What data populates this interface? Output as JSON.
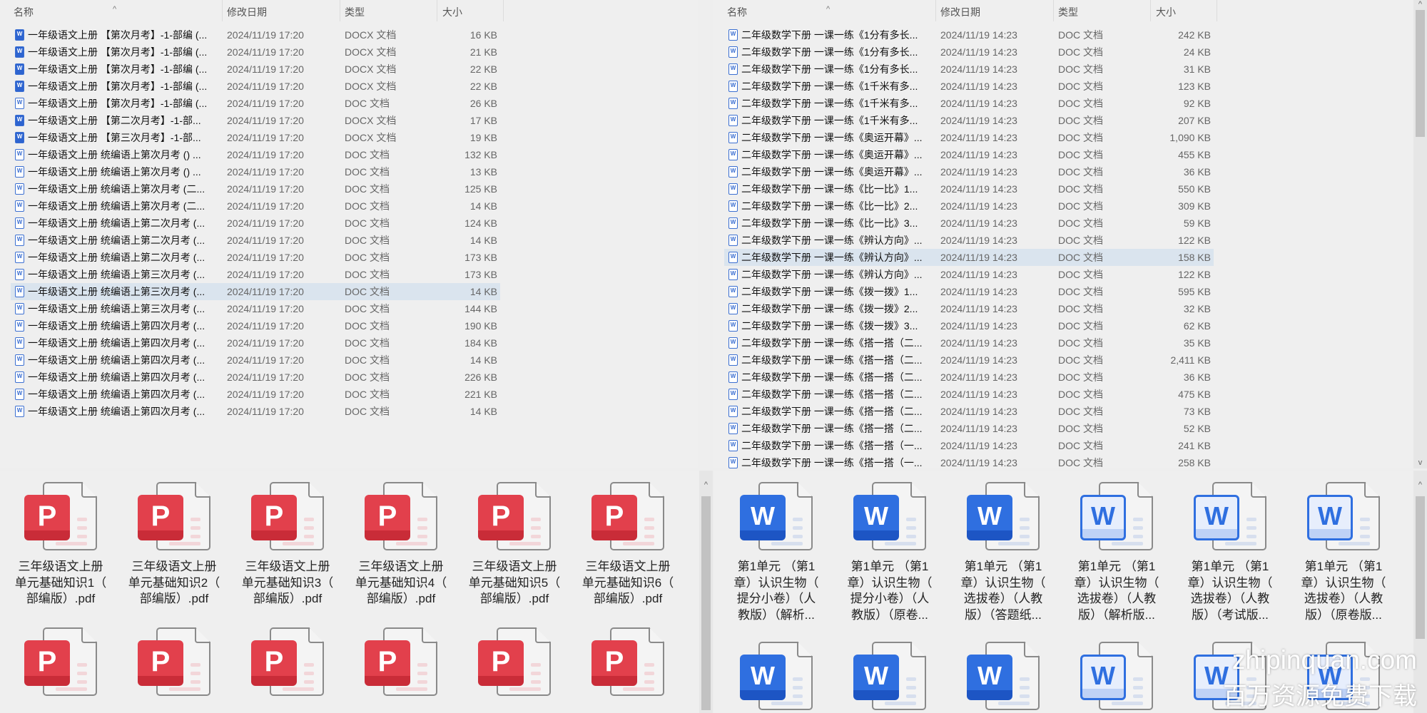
{
  "left_list": {
    "columns": {
      "name": "名称",
      "date": "修改日期",
      "type": "类型",
      "size": "大小"
    },
    "selected_index": 15,
    "rows": [
      {
        "name": "一年级语文上册 【第次月考】-1-部编 (...",
        "date": "2024/11/19 17:20",
        "type": "DOCX 文档",
        "size": "16 KB",
        "icon": "docx"
      },
      {
        "name": "一年级语文上册 【第次月考】-1-部编 (...",
        "date": "2024/11/19 17:20",
        "type": "DOCX 文档",
        "size": "21 KB",
        "icon": "docx"
      },
      {
        "name": "一年级语文上册 【第次月考】-1-部编 (...",
        "date": "2024/11/19 17:20",
        "type": "DOCX 文档",
        "size": "22 KB",
        "icon": "docx"
      },
      {
        "name": "一年级语文上册 【第次月考】-1-部编 (...",
        "date": "2024/11/19 17:20",
        "type": "DOCX 文档",
        "size": "22 KB",
        "icon": "docx"
      },
      {
        "name": "一年级语文上册 【第次月考】-1-部编 (...",
        "date": "2024/11/19 17:20",
        "type": "DOC 文档",
        "size": "26 KB",
        "icon": "doc"
      },
      {
        "name": "一年级语文上册 【第二次月考】-1-部...",
        "date": "2024/11/19 17:20",
        "type": "DOCX 文档",
        "size": "17 KB",
        "icon": "docx"
      },
      {
        "name": "一年级语文上册 【第三次月考】-1-部...",
        "date": "2024/11/19 17:20",
        "type": "DOCX 文档",
        "size": "19 KB",
        "icon": "docx"
      },
      {
        "name": "一年级语文上册 统编语上第次月考 () ...",
        "date": "2024/11/19 17:20",
        "type": "DOC 文档",
        "size": "132 KB",
        "icon": "doc"
      },
      {
        "name": "一年级语文上册 统编语上第次月考 () ...",
        "date": "2024/11/19 17:20",
        "type": "DOC 文档",
        "size": "13 KB",
        "icon": "doc"
      },
      {
        "name": "一年级语文上册 统编语上第次月考 (二...",
        "date": "2024/11/19 17:20",
        "type": "DOC 文档",
        "size": "125 KB",
        "icon": "doc"
      },
      {
        "name": "一年级语文上册 统编语上第次月考 (二...",
        "date": "2024/11/19 17:20",
        "type": "DOC 文档",
        "size": "14 KB",
        "icon": "doc"
      },
      {
        "name": "一年级语文上册 统编语上第二次月考 (...",
        "date": "2024/11/19 17:20",
        "type": "DOC 文档",
        "size": "124 KB",
        "icon": "doc"
      },
      {
        "name": "一年级语文上册 统编语上第二次月考 (...",
        "date": "2024/11/19 17:20",
        "type": "DOC 文档",
        "size": "14 KB",
        "icon": "doc"
      },
      {
        "name": "一年级语文上册 统编语上第二次月考 (...",
        "date": "2024/11/19 17:20",
        "type": "DOC 文档",
        "size": "173 KB",
        "icon": "doc"
      },
      {
        "name": "一年级语文上册 统编语上第三次月考 (...",
        "date": "2024/11/19 17:20",
        "type": "DOC 文档",
        "size": "173 KB",
        "icon": "doc"
      },
      {
        "name": "一年级语文上册 统编语上第三次月考 (...",
        "date": "2024/11/19 17:20",
        "type": "DOC 文档",
        "size": "14 KB",
        "icon": "doc"
      },
      {
        "name": "一年级语文上册 统编语上第三次月考 (...",
        "date": "2024/11/19 17:20",
        "type": "DOC 文档",
        "size": "144 KB",
        "icon": "doc"
      },
      {
        "name": "一年级语文上册 统编语上第四次月考 (...",
        "date": "2024/11/19 17:20",
        "type": "DOC 文档",
        "size": "190 KB",
        "icon": "doc"
      },
      {
        "name": "一年级语文上册 统编语上第四次月考 (...",
        "date": "2024/11/19 17:20",
        "type": "DOC 文档",
        "size": "184 KB",
        "icon": "doc"
      },
      {
        "name": "一年级语文上册 统编语上第四次月考 (...",
        "date": "2024/11/19 17:20",
        "type": "DOC 文档",
        "size": "14 KB",
        "icon": "doc"
      },
      {
        "name": "一年级语文上册 统编语上第四次月考 (...",
        "date": "2024/11/19 17:20",
        "type": "DOC 文档",
        "size": "226 KB",
        "icon": "doc"
      },
      {
        "name": "一年级语文上册 统编语上第四次月考 (...",
        "date": "2024/11/19 17:20",
        "type": "DOC 文档",
        "size": "221 KB",
        "icon": "doc"
      },
      {
        "name": "一年级语文上册 统编语上第四次月考 (...",
        "date": "2024/11/19 17:20",
        "type": "DOC 文档",
        "size": "14 KB",
        "icon": "doc"
      }
    ]
  },
  "right_list": {
    "columns": {
      "name": "名称",
      "date": "修改日期",
      "type": "类型",
      "size": "大小"
    },
    "selected_index": 13,
    "rows": [
      {
        "name": "二年级数学下册 一课一练《1分有多长...",
        "date": "2024/11/19 14:23",
        "type": "DOC 文档",
        "size": "242 KB",
        "icon": "doc"
      },
      {
        "name": "二年级数学下册 一课一练《1分有多长...",
        "date": "2024/11/19 14:23",
        "type": "DOC 文档",
        "size": "24 KB",
        "icon": "doc"
      },
      {
        "name": "二年级数学下册 一课一练《1分有多长...",
        "date": "2024/11/19 14:23",
        "type": "DOC 文档",
        "size": "31 KB",
        "icon": "doc"
      },
      {
        "name": "二年级数学下册 一课一练《1千米有多...",
        "date": "2024/11/19 14:23",
        "type": "DOC 文档",
        "size": "123 KB",
        "icon": "doc"
      },
      {
        "name": "二年级数学下册 一课一练《1千米有多...",
        "date": "2024/11/19 14:23",
        "type": "DOC 文档",
        "size": "92 KB",
        "icon": "doc"
      },
      {
        "name": "二年级数学下册 一课一练《1千米有多...",
        "date": "2024/11/19 14:23",
        "type": "DOC 文档",
        "size": "207 KB",
        "icon": "doc"
      },
      {
        "name": "二年级数学下册 一课一练《奥运开幕》...",
        "date": "2024/11/19 14:23",
        "type": "DOC 文档",
        "size": "1,090 KB",
        "icon": "doc"
      },
      {
        "name": "二年级数学下册 一课一练《奥运开幕》...",
        "date": "2024/11/19 14:23",
        "type": "DOC 文档",
        "size": "455 KB",
        "icon": "doc"
      },
      {
        "name": "二年级数学下册 一课一练《奥运开幕》...",
        "date": "2024/11/19 14:23",
        "type": "DOC 文档",
        "size": "36 KB",
        "icon": "doc"
      },
      {
        "name": "二年级数学下册 一课一练《比一比》1...",
        "date": "2024/11/19 14:23",
        "type": "DOC 文档",
        "size": "550 KB",
        "icon": "doc"
      },
      {
        "name": "二年级数学下册 一课一练《比一比》2...",
        "date": "2024/11/19 14:23",
        "type": "DOC 文档",
        "size": "309 KB",
        "icon": "doc"
      },
      {
        "name": "二年级数学下册 一课一练《比一比》3...",
        "date": "2024/11/19 14:23",
        "type": "DOC 文档",
        "size": "59 KB",
        "icon": "doc"
      },
      {
        "name": "二年级数学下册 一课一练《辨认方向》...",
        "date": "2024/11/19 14:23",
        "type": "DOC 文档",
        "size": "122 KB",
        "icon": "doc"
      },
      {
        "name": "二年级数学下册 一课一练《辨认方向》...",
        "date": "2024/11/19 14:23",
        "type": "DOC 文档",
        "size": "158 KB",
        "icon": "doc"
      },
      {
        "name": "二年级数学下册 一课一练《辨认方向》...",
        "date": "2024/11/19 14:23",
        "type": "DOC 文档",
        "size": "122 KB",
        "icon": "doc"
      },
      {
        "name": "二年级数学下册 一课一练《拨一拨》1...",
        "date": "2024/11/19 14:23",
        "type": "DOC 文档",
        "size": "595 KB",
        "icon": "doc"
      },
      {
        "name": "二年级数学下册 一课一练《拨一拨》2...",
        "date": "2024/11/19 14:23",
        "type": "DOC 文档",
        "size": "32 KB",
        "icon": "doc"
      },
      {
        "name": "二年级数学下册 一课一练《拨一拨》3...",
        "date": "2024/11/19 14:23",
        "type": "DOC 文档",
        "size": "62 KB",
        "icon": "doc"
      },
      {
        "name": "二年级数学下册 一课一练《搭一搭（二...",
        "date": "2024/11/19 14:23",
        "type": "DOC 文档",
        "size": "35 KB",
        "icon": "doc"
      },
      {
        "name": "二年级数学下册 一课一练《搭一搭（二...",
        "date": "2024/11/19 14:23",
        "type": "DOC 文档",
        "size": "2,411 KB",
        "icon": "doc"
      },
      {
        "name": "二年级数学下册 一课一练《搭一搭（二...",
        "date": "2024/11/19 14:23",
        "type": "DOC 文档",
        "size": "36 KB",
        "icon": "doc"
      },
      {
        "name": "二年级数学下册 一课一练《搭一搭（二...",
        "date": "2024/11/19 14:23",
        "type": "DOC 文档",
        "size": "475 KB",
        "icon": "doc"
      },
      {
        "name": "二年级数学下册 一课一练《搭一搭（二...",
        "date": "2024/11/19 14:23",
        "type": "DOC 文档",
        "size": "73 KB",
        "icon": "doc"
      },
      {
        "name": "二年级数学下册 一课一练《搭一搭（二...",
        "date": "2024/11/19 14:23",
        "type": "DOC 文档",
        "size": "52 KB",
        "icon": "doc"
      },
      {
        "name": "二年级数学下册 一课一练《搭一搭（一...",
        "date": "2024/11/19 14:23",
        "type": "DOC 文档",
        "size": "241 KB",
        "icon": "doc"
      },
      {
        "name": "二年级数学下册 一课一练《搭一搭（一...",
        "date": "2024/11/19 14:23",
        "type": "DOC 文档",
        "size": "258 KB",
        "icon": "doc"
      }
    ]
  },
  "left_grid": {
    "tiles": [
      {
        "lines": [
          "三年级语文上册",
          "单元基础知识1（",
          "部编版）.pdf"
        ],
        "icon": "pdf"
      },
      {
        "lines": [
          "三年级语文上册",
          "单元基础知识2（",
          "部编版）.pdf"
        ],
        "icon": "pdf"
      },
      {
        "lines": [
          "三年级语文上册",
          "单元基础知识3（",
          "部编版）.pdf"
        ],
        "icon": "pdf"
      },
      {
        "lines": [
          "三年级语文上册",
          "单元基础知识4（",
          "部编版）.pdf"
        ],
        "icon": "pdf"
      },
      {
        "lines": [
          "三年级语文上册",
          "单元基础知识5（",
          "部编版）.pdf"
        ],
        "icon": "pdf"
      },
      {
        "lines": [
          "三年级语文上册",
          "单元基础知识6（",
          "部编版）.pdf"
        ],
        "icon": "pdf"
      }
    ],
    "second_row_icons": [
      "pdf",
      "pdf",
      "pdf",
      "pdf",
      "pdf",
      "pdf"
    ],
    "pdf_glyph": "P"
  },
  "right_grid": {
    "tiles": [
      {
        "lines": [
          "第1单元 （第1",
          "章）认识生物（",
          "提分小卷）（人",
          "教版）（解析..."
        ],
        "icon": "docx"
      },
      {
        "lines": [
          "第1单元 （第1",
          "章）认识生物（",
          "提分小卷）（人",
          "教版）（原卷..."
        ],
        "icon": "docx"
      },
      {
        "lines": [
          "第1单元 （第1",
          "章）认识生物（",
          "选拔卷）（人教",
          "版）（答题纸..."
        ],
        "icon": "docx"
      },
      {
        "lines": [
          "第1单元 （第1",
          "章）认识生物（",
          "选拔卷）（人教",
          "版）（解析版..."
        ],
        "icon": "doc"
      },
      {
        "lines": [
          "第1单元 （第1",
          "章）认识生物（",
          "选拔卷）（人教",
          "版）（考试版..."
        ],
        "icon": "doc"
      },
      {
        "lines": [
          "第1单元 （第1",
          "章）认识生物（",
          "选拔卷）（人教",
          "版）（原卷版..."
        ],
        "icon": "doc"
      }
    ],
    "second_row_icons": [
      "docx",
      "docx",
      "docx",
      "doc",
      "doc",
      "doc"
    ],
    "word_glyph": "W"
  },
  "watermark": {
    "line1": "zhipinquan.com",
    "line2": "百万资源免费下载"
  }
}
